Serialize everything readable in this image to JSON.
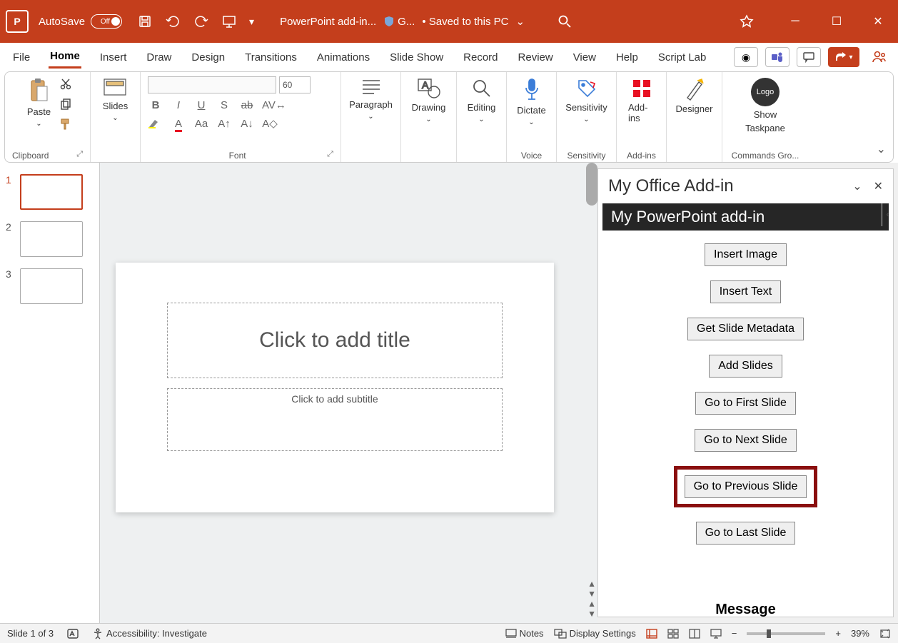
{
  "titlebar": {
    "app_glyph": "P",
    "autosave_label": "AutoSave",
    "autosave_state": "Off",
    "doc_name": "PowerPoint add-in...",
    "shield_label": "G...",
    "save_status": "• Saved to this PC"
  },
  "tabs": [
    "File",
    "Home",
    "Insert",
    "Draw",
    "Design",
    "Transitions",
    "Animations",
    "Slide Show",
    "Record",
    "Review",
    "View",
    "Help",
    "Script Lab"
  ],
  "active_tab": "Home",
  "ribbon": {
    "clipboard": {
      "paste": "Paste",
      "label": "Clipboard"
    },
    "slides": {
      "btn": "Slides",
      "label": ""
    },
    "font": {
      "label": "Font",
      "size_value": "60"
    },
    "paragraph": {
      "btn": "Paragraph"
    },
    "drawing": {
      "btn": "Drawing"
    },
    "editing": {
      "btn": "Editing"
    },
    "dictate": {
      "btn": "Dictate",
      "label": "Voice"
    },
    "sensitivity": {
      "btn": "Sensitivity",
      "label": "Sensitivity"
    },
    "addins": {
      "btn": "Add-ins",
      "label": "Add-ins"
    },
    "designer": {
      "btn": "Designer"
    },
    "taskpane": {
      "line1": "Show",
      "line2": "Taskpane",
      "circle": "Logo"
    },
    "commands_label": "Commands Gro..."
  },
  "thumbs": [
    {
      "num": "1",
      "selected": true
    },
    {
      "num": "2",
      "selected": false
    },
    {
      "num": "3",
      "selected": false
    }
  ],
  "slide": {
    "title_placeholder": "Click to add title",
    "subtitle_placeholder": "Click to add subtitle"
  },
  "pane": {
    "header": "My Office Add-in",
    "title": "My PowerPoint add-in",
    "buttons": {
      "insert_image": "Insert Image",
      "insert_text": "Insert Text",
      "get_meta": "Get Slide Metadata",
      "add_slides": "Add Slides",
      "go_first": "Go to First Slide",
      "go_next": "Go to Next Slide",
      "go_prev": "Go to Previous Slide",
      "go_last": "Go to Last Slide"
    },
    "message_heading": "Message"
  },
  "status": {
    "slide_info": "Slide 1 of 3",
    "accessibility": "Accessibility: Investigate",
    "notes": "Notes",
    "display_settings": "Display Settings",
    "zoom": "39%"
  }
}
